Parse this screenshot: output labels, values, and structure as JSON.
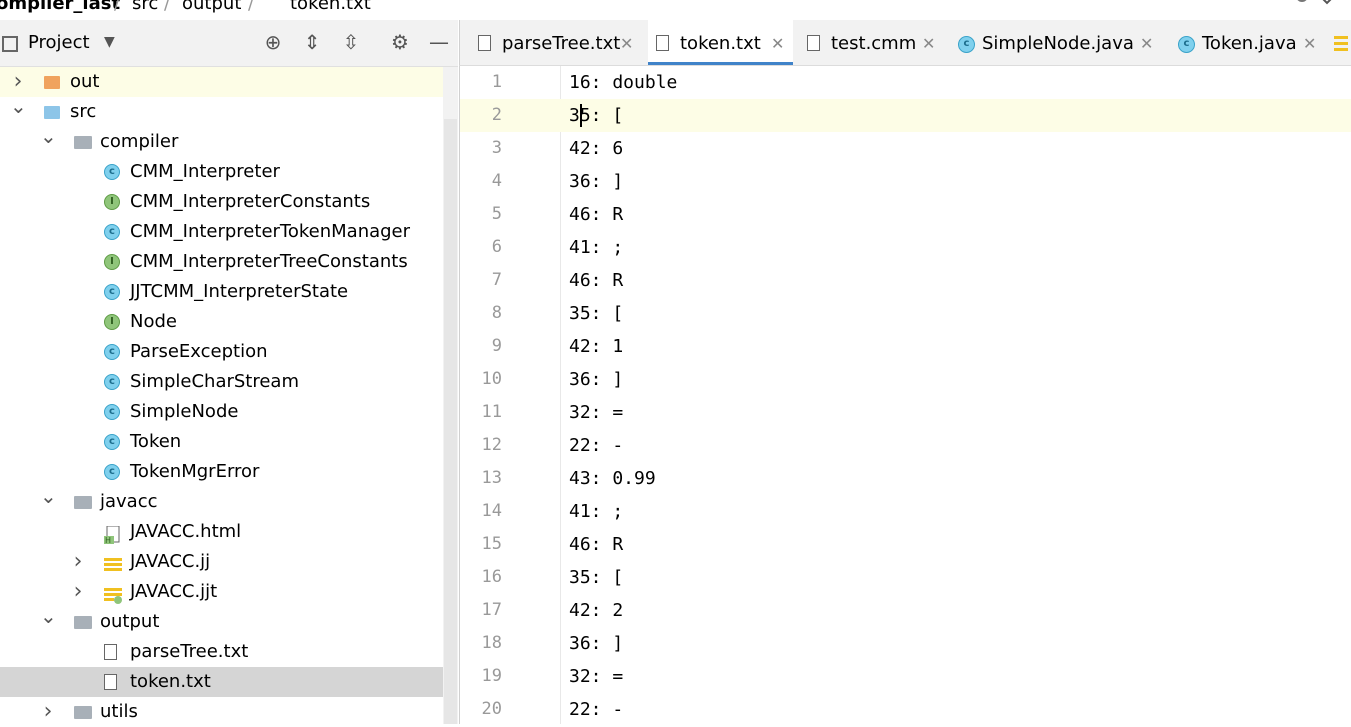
{
  "breadcrumb": {
    "items": [
      "ompiler_last",
      "src",
      "output",
      "token.txt"
    ],
    "separator": "/"
  },
  "project_panel": {
    "title": "Project",
    "tools": [
      "locate-icon",
      "expand-all-icon",
      "collapse-all-icon",
      "gear-icon",
      "minimize-icon"
    ]
  },
  "tree": [
    {
      "label": "out",
      "depth": 0,
      "type": "folder-orange",
      "expand": "collapsed",
      "highlight": true
    },
    {
      "label": "src",
      "depth": 0,
      "type": "folder",
      "expand": "expanded"
    },
    {
      "label": "compiler",
      "depth": 1,
      "type": "package",
      "expand": "expanded"
    },
    {
      "label": "CMM_Interpreter",
      "depth": 2,
      "type": "class"
    },
    {
      "label": "CMM_InterpreterConstants",
      "depth": 2,
      "type": "interface"
    },
    {
      "label": "CMM_InterpreterTokenManager",
      "depth": 2,
      "type": "class"
    },
    {
      "label": "CMM_InterpreterTreeConstants",
      "depth": 2,
      "type": "interface"
    },
    {
      "label": "JJTCMM_InterpreterState",
      "depth": 2,
      "type": "class"
    },
    {
      "label": "Node",
      "depth": 2,
      "type": "interface"
    },
    {
      "label": "ParseException",
      "depth": 2,
      "type": "class"
    },
    {
      "label": "SimpleCharStream",
      "depth": 2,
      "type": "class"
    },
    {
      "label": "SimpleNode",
      "depth": 2,
      "type": "class"
    },
    {
      "label": "Token",
      "depth": 2,
      "type": "class"
    },
    {
      "label": "TokenMgrError",
      "depth": 2,
      "type": "class"
    },
    {
      "label": "javacc",
      "depth": 1,
      "type": "package",
      "expand": "expanded"
    },
    {
      "label": "JAVACC.html",
      "depth": 2,
      "type": "html"
    },
    {
      "label": "JAVACC.jj",
      "depth": 2,
      "type": "jj",
      "expand": "collapsed"
    },
    {
      "label": "JAVACC.jjt",
      "depth": 2,
      "type": "jjt",
      "expand": "collapsed"
    },
    {
      "label": "output",
      "depth": 1,
      "type": "package",
      "expand": "expanded"
    },
    {
      "label": "parseTree.txt",
      "depth": 2,
      "type": "txt"
    },
    {
      "label": "token.txt",
      "depth": 2,
      "type": "txt",
      "selected": true
    },
    {
      "label": "utils",
      "depth": 1,
      "type": "package",
      "expand": "collapsed"
    }
  ],
  "tabs": [
    {
      "label": "parseTree.txt",
      "icon": "text-file-icon",
      "active": false
    },
    {
      "label": "token.txt",
      "icon": "text-file-icon",
      "active": true
    },
    {
      "label": "test.cmm",
      "icon": "text-file-icon",
      "active": false
    },
    {
      "label": "SimpleNode.java",
      "icon": "class-icon",
      "active": false
    },
    {
      "label": "Token.java",
      "icon": "class-icon",
      "active": false
    }
  ],
  "editor": {
    "current_line": 2,
    "lines": [
      "16: double",
      "35: [",
      "42: 6",
      "36: ]",
      "46: R",
      "41: ;",
      "46: R",
      "35: [",
      "42: 1",
      "36: ]",
      "32: =",
      "22: -",
      "43: 0.99",
      "41: ;",
      "46: R",
      "35: [",
      "42: 2",
      "36: ]",
      "32: =",
      "22: -"
    ]
  },
  "colors": {
    "class_icon": "#7fd0ed",
    "interface_icon": "#8fc57a",
    "active_tab_underline": "#4083c9",
    "current_line_bg": "#fdfde6",
    "selection_bg": "#d5d5d5"
  }
}
